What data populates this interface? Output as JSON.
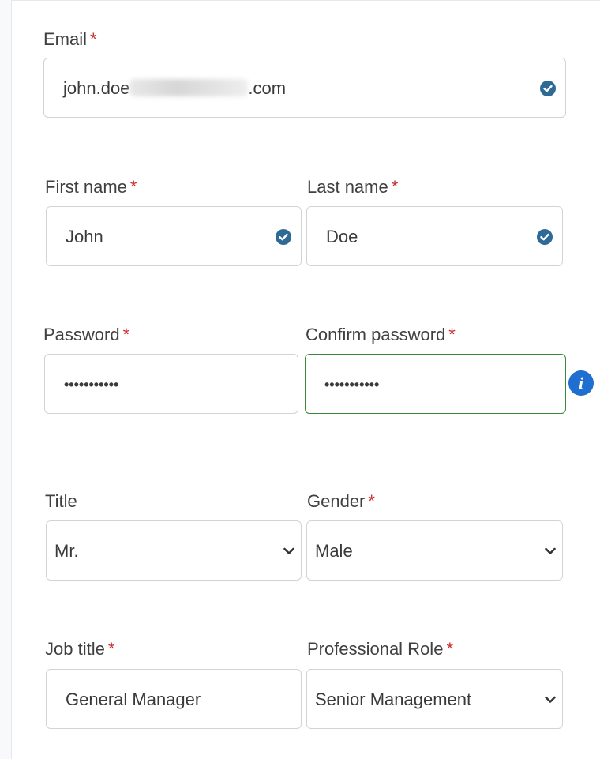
{
  "email": {
    "label": "Email",
    "required_mark": "*",
    "value_prefix": "john.doe",
    "value_suffix": ".com",
    "status_icon": "check-circle-icon"
  },
  "first_name": {
    "label": "First name",
    "required_mark": "*",
    "value": "John",
    "status_icon": "check-circle-icon"
  },
  "last_name": {
    "label": "Last name",
    "required_mark": "*",
    "value": "Doe",
    "status_icon": "check-circle-icon"
  },
  "password": {
    "label": "Password",
    "required_mark": "*",
    "masked_value": "•••••••••••"
  },
  "confirm_password": {
    "label": "Confirm password",
    "required_mark": "*",
    "masked_value": "•••••••••••",
    "info_icon": "info-icon"
  },
  "title": {
    "label": "Title",
    "selected": "Mr."
  },
  "gender": {
    "label": "Gender",
    "required_mark": "*",
    "selected": "Male"
  },
  "job_title": {
    "label": "Job title",
    "required_mark": "*",
    "value": "General Manager"
  },
  "professional_role": {
    "label": "Professional Role",
    "required_mark": "*",
    "selected": "Senior Management"
  },
  "colors": {
    "required": "#cc2a2a",
    "check": "#2d6a96",
    "info": "#1f6fd1",
    "valid_border": "#3a8a3a"
  }
}
